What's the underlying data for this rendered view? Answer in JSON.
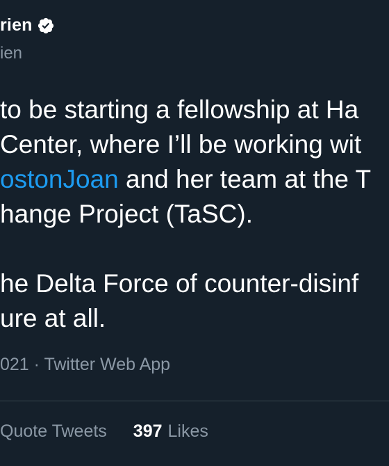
{
  "author": {
    "name": "rien",
    "handle": "ien",
    "verified_icon": "verified-badge-icon"
  },
  "tweet": {
    "line1": "to be starting a fellowship at Ha",
    "line2": "Center, where I’ll be working wit",
    "line3_mention": "ostonJoan",
    "line3_rest": " and her team at the T",
    "line4": "hange Project (TaSC).",
    "line6": "he Delta Force of counter-disinf",
    "line7": "ure at all."
  },
  "meta": {
    "timestamp_fragment": "021",
    "separator": " · ",
    "source": "Twitter Web App"
  },
  "stats": {
    "quote_tweets_label": "Quote Tweets",
    "likes_count": "397",
    "likes_label": "Likes"
  },
  "colors": {
    "background": "#15202b",
    "mention": "#1d9bf0",
    "secondary_text": "#8b98a5",
    "divider": "#38444d"
  }
}
